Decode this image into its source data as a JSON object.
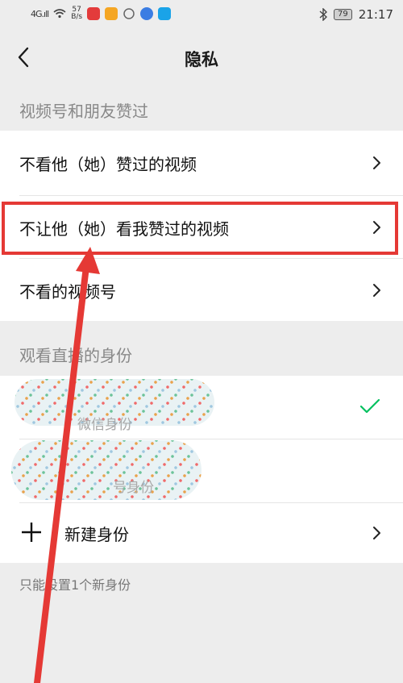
{
  "status_bar": {
    "signal": "4G.ıll",
    "speed_value": "57",
    "speed_unit": "B/s",
    "battery": "79",
    "time": "21:17"
  },
  "nav": {
    "back_icon": "chevron-left-icon",
    "title": "隐私"
  },
  "sections": {
    "channels_likes": {
      "header": "视频号和朋友赞过",
      "items": [
        {
          "label": "不看他（她）赞过的视频"
        },
        {
          "label": "不让他（她）看我赞过的视频"
        },
        {
          "label": "不看的视频号"
        }
      ]
    },
    "live_identity": {
      "header": "观看直播的身份",
      "items": [
        {
          "label": "微信身份",
          "selected": true
        },
        {
          "label": "号身份",
          "selected": false
        }
      ],
      "new_identity_label": "新建身份",
      "footnote": "只能设置1个新身份"
    }
  },
  "colors": {
    "background": "#ededed",
    "card": "#ffffff",
    "checkmark": "#07c160",
    "annotation": "#e53935"
  }
}
